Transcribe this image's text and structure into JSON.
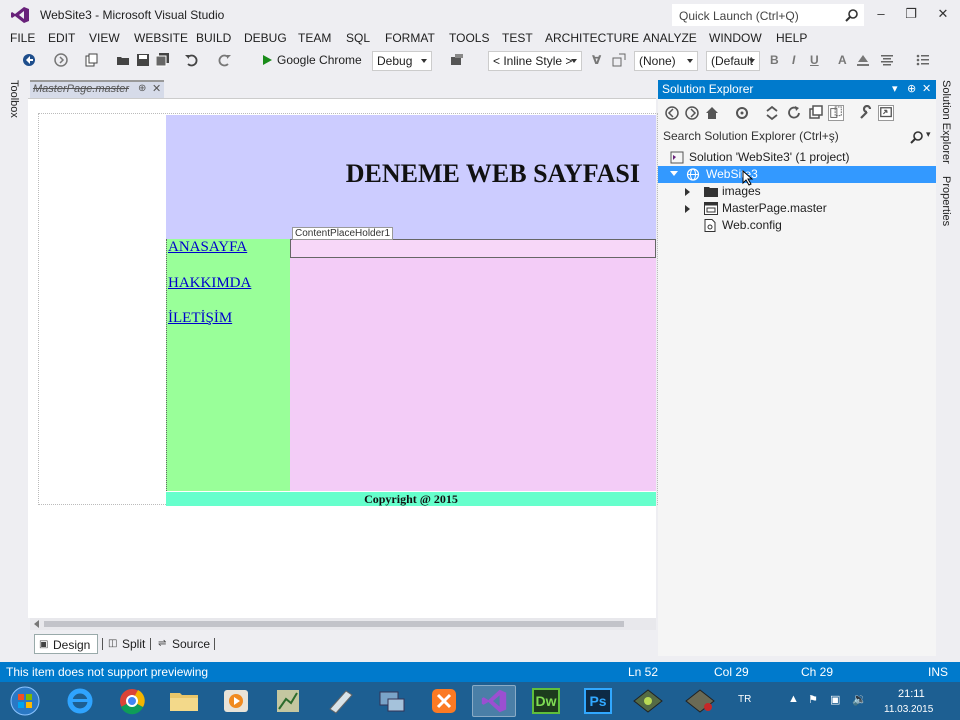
{
  "window": {
    "title": "WebSite3 - Microsoft Visual Studio",
    "quick_launch_placeholder": "Quick Launch (Ctrl+Q)"
  },
  "menu": [
    "FILE",
    "EDIT",
    "VIEW",
    "WEBSITE",
    "BUILD",
    "DEBUG",
    "TEAM",
    "SQL",
    "FORMAT",
    "TOOLS",
    "TEST",
    "ARCHITECTURE",
    "ANALYZE",
    "WINDOW",
    "HELP"
  ],
  "toolbar": {
    "run_target": "Google Chrome",
    "configuration": "Debug",
    "style_target": "< Inline Style >",
    "font_name": "(None)",
    "font_size": "(Default",
    "bold": "B",
    "italic": "I",
    "underline": "U"
  },
  "side_labels": {
    "toolbox": "Toolbox",
    "solution_explorer": "Solution Explorer",
    "properties": "Properties"
  },
  "document": {
    "tab_label": "MasterPage.master",
    "site_title": "DENEME WEB SAYFASI",
    "nav_links": [
      "ANASAYFA",
      "HAKKIMDA",
      "İLETİŞİM"
    ],
    "placeholder_tag": "ContentPlaceHolder1",
    "footer": "Copyright @ 2015"
  },
  "view_tabs": {
    "design": "Design",
    "split": "Split",
    "source": "Source"
  },
  "solution_explorer": {
    "title": "Solution Explorer",
    "search_placeholder": "Search Solution Explorer (Ctrl+ş)",
    "tree": {
      "solution": "Solution 'WebSite3' (1 project)",
      "project": "WebSite3",
      "images": "images",
      "master": "MasterPage.master",
      "config": "Web.config"
    }
  },
  "status": {
    "message": "This item does not support previewing",
    "line": "Ln 52",
    "col": "Col 29",
    "ch": "Ch 29",
    "mode": "INS"
  },
  "taskbar": {
    "language": "TR",
    "time": "21:11",
    "date": "11.03.2015",
    "dw_label": "Dw",
    "ps_label": "Ps"
  },
  "colors": {
    "accent": "#007acc",
    "header_band": "#ccccff",
    "nav_band": "#99ff99",
    "content_band": "#f3ccf7",
    "footer_band": "#66ffcc",
    "selection": "#3399ff"
  }
}
